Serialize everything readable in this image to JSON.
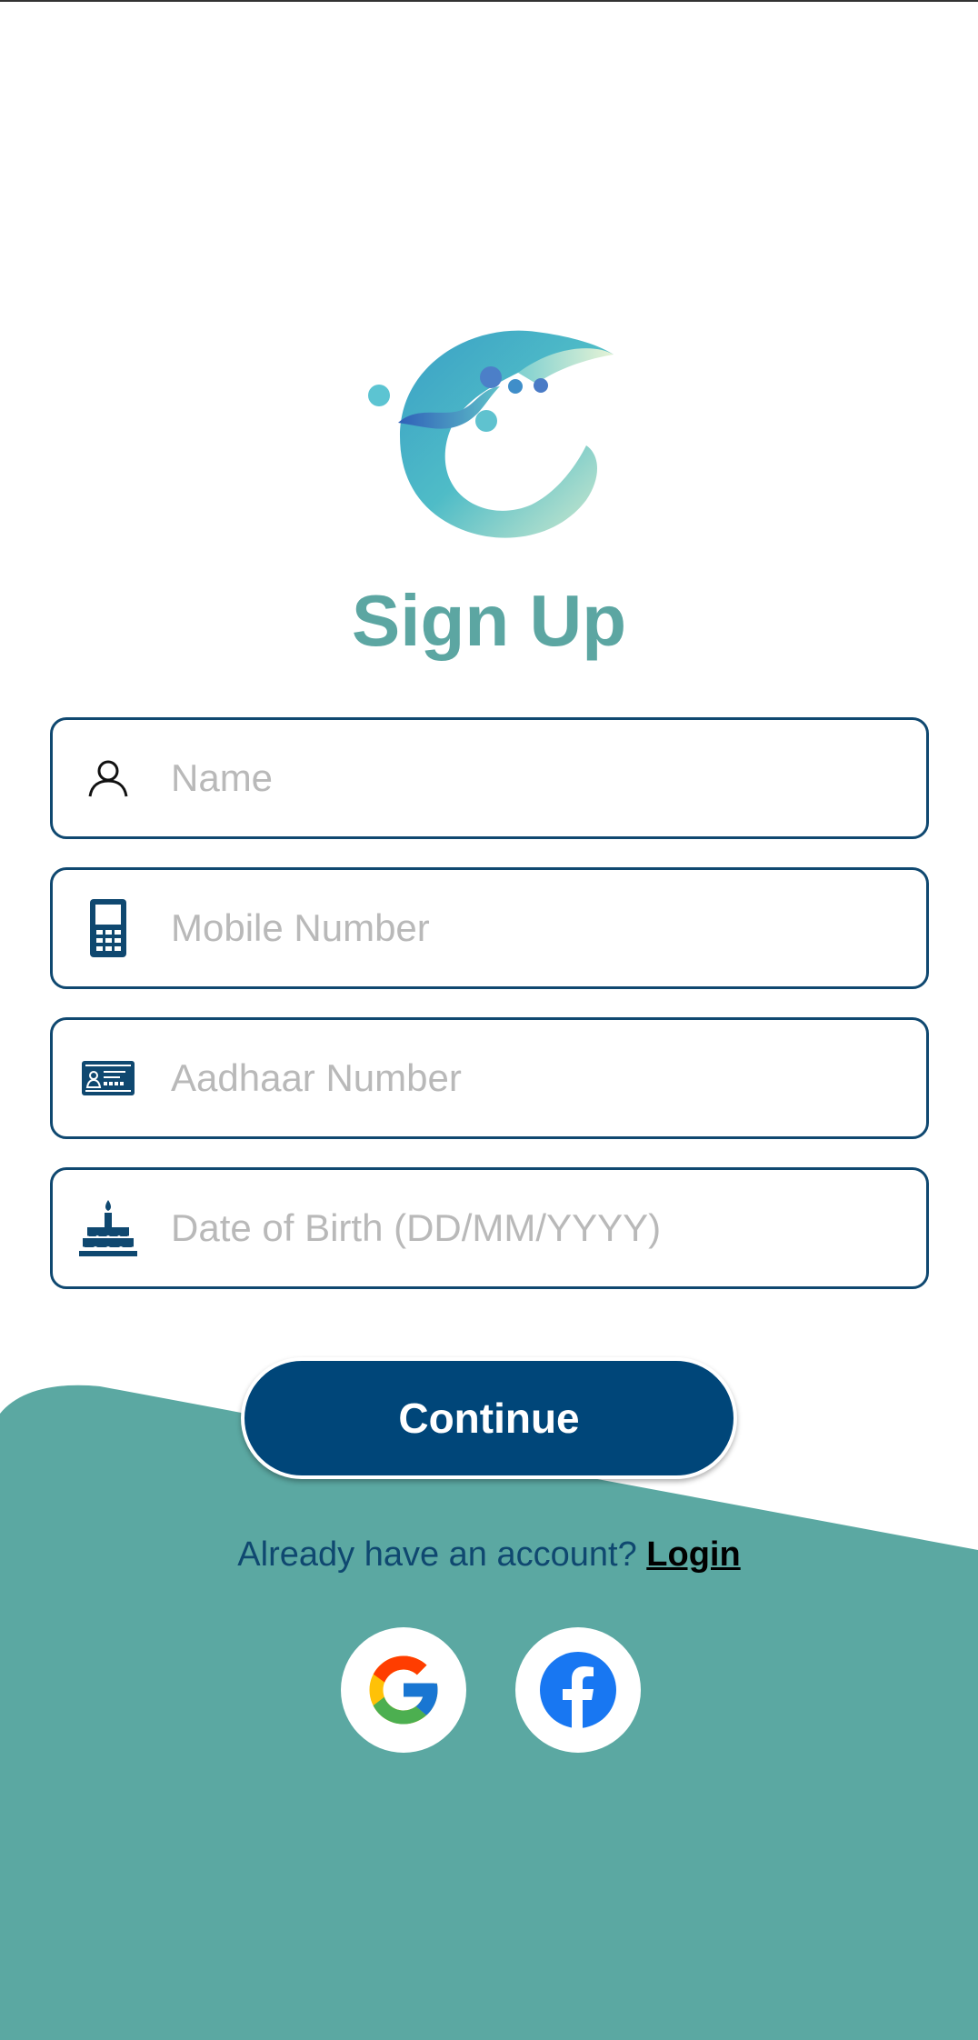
{
  "brand": {
    "logo_icon": "wave-c-logo-icon",
    "title_color": "#5ca6a2",
    "primary_color": "#004679",
    "background_accent": "#5ba8a2"
  },
  "page": {
    "title": "Sign Up"
  },
  "form": {
    "name": {
      "placeholder": "Name",
      "value": "",
      "icon": "person-icon"
    },
    "mobile": {
      "placeholder": "Mobile Number",
      "value": "",
      "icon": "mobile-phone-icon"
    },
    "aadhaar": {
      "placeholder": "Aadhaar Number",
      "value": "",
      "icon": "id-card-icon"
    },
    "dob": {
      "placeholder": "Date of Birth (DD/MM/YYYY)",
      "value": "",
      "icon": "birthday-cake-icon"
    }
  },
  "actions": {
    "continue_label": "Continue",
    "login_prompt": "Already have an account?",
    "login_label": "Login"
  },
  "social": [
    {
      "name": "Google",
      "icon": "google-icon"
    },
    {
      "name": "Facebook",
      "icon": "facebook-icon"
    }
  ]
}
